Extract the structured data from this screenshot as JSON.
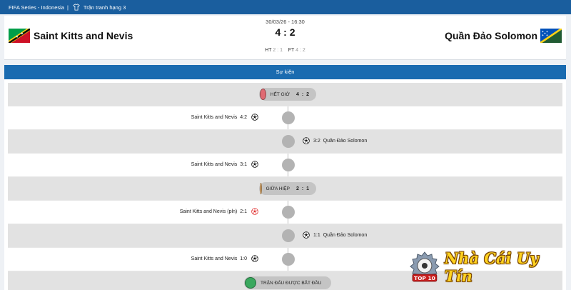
{
  "topbar": {
    "competition": "FIFA Series - Indonesia",
    "separator": "|",
    "round": "Trận tranh hạng 3"
  },
  "match": {
    "datetime": "30/03/26 - 16:30",
    "score": "4 : 2",
    "home_team": "Saint Kitts and Nevis",
    "away_team": "Quần Đảo Solomon",
    "ht_label": "HT",
    "ht_score": "2 : 1",
    "ft_label": "FT",
    "ft_score": "4 : 2"
  },
  "events_section": {
    "title": "Sự kiện",
    "rows": [
      {
        "type": "status",
        "label": "HẾT GIỜ",
        "score": "4 : 2",
        "color": "#e06a72"
      },
      {
        "type": "goal",
        "side": "home",
        "team": "Saint Kitts and Nevis",
        "score": "4:2",
        "ball": "normal"
      },
      {
        "type": "goal",
        "side": "away",
        "team": "Quần Đảo Solomon",
        "score": "3:2",
        "ball": "normal"
      },
      {
        "type": "goal",
        "side": "home",
        "team": "Saint Kitts and Nevis",
        "score": "3:1",
        "ball": "normal"
      },
      {
        "type": "status",
        "label": "GIỮA HIỆP",
        "score": "2 : 1",
        "color": "#e5b06e"
      },
      {
        "type": "goal",
        "side": "home",
        "team": "Saint Kitts and Nevis (pln)",
        "score": "2:1",
        "ball": "penalty"
      },
      {
        "type": "goal",
        "side": "away",
        "team": "Quần Đảo Solomon",
        "score": "1:1",
        "ball": "normal"
      },
      {
        "type": "goal",
        "side": "home",
        "team": "Saint Kitts and Nevis",
        "score": "1:0",
        "ball": "normal"
      },
      {
        "type": "status",
        "label": "TRẬN ĐẤU ĐƯỢC BẮT ĐẦU",
        "score": "",
        "color": "#3aa85e"
      }
    ]
  },
  "watermark": {
    "badge": "TOP 10",
    "brand": "Nhà Cái Uy Tín"
  },
  "colors": {
    "topbar": "#1a5e9e",
    "section_header": "#1a6bb0",
    "row_shade": "#e2e2e2",
    "timeline_dot": "#b3b3b3"
  }
}
